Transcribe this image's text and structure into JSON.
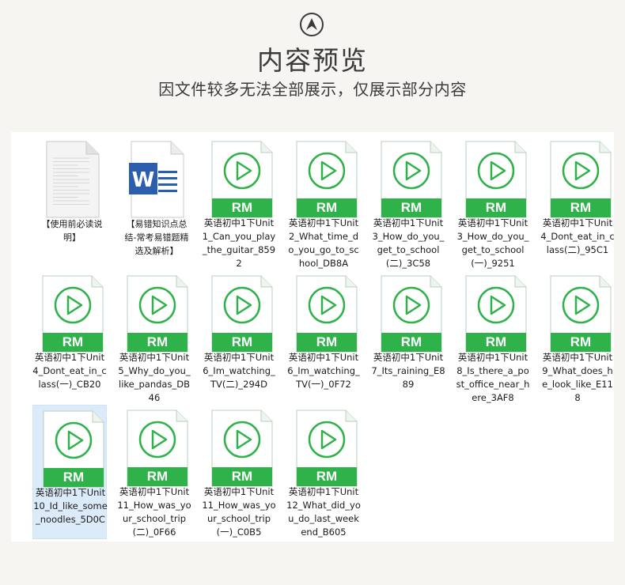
{
  "header": {
    "icon": "chevron-up-circle-icon",
    "title": "内容预览",
    "subtitle": "因文件较多无法全部展示，仅展示部分内容"
  },
  "colors": {
    "background": "#f7f5f1",
    "panel": "#ffffff",
    "rm_green": "#2fb24a",
    "text": "#3a3a3a",
    "selection": "#dcebfa",
    "word_blue": "#2b5fad"
  },
  "files": [
    {
      "type": "text-document-icon",
      "name": "【使用前必读说明】"
    },
    {
      "type": "word-document-icon",
      "name": "【易错知识点总结-常考易错题精选及解析】"
    },
    {
      "type": "rm-media-icon",
      "badge": "RM",
      "name": "英语初中1下Unit1_Can_you_play_the_guitar_8592"
    },
    {
      "type": "rm-media-icon",
      "badge": "RM",
      "name": "英语初中1下Unit2_What_time_do_you_go_to_school_DB8A"
    },
    {
      "type": "rm-media-icon",
      "badge": "RM",
      "name": "英语初中1下Unit3_How_do_you_get_to_school(二)_3C58"
    },
    {
      "type": "rm-media-icon",
      "badge": "RM",
      "name": "英语初中1下Unit3_How_do_you_get_to_school(一)_9251"
    },
    {
      "type": "rm-media-icon",
      "badge": "RM",
      "name": "英语初中1下Unit4_Dont_eat_in_class(二)_95C1"
    },
    {
      "type": "rm-media-icon",
      "badge": "RM",
      "name": "英语初中1下Unit4_Dont_eat_in_class(一)_CB20"
    },
    {
      "type": "rm-media-icon",
      "badge": "RM",
      "name": "英语初中1下Unit5_Why_do_you_like_pandas_DB46"
    },
    {
      "type": "rm-media-icon",
      "badge": "RM",
      "name": "英语初中1下Unit6_Im_watching_TV(二)_294D"
    },
    {
      "type": "rm-media-icon",
      "badge": "RM",
      "name": "英语初中1下Unit6_Im_watching_TV(一)_0F72"
    },
    {
      "type": "rm-media-icon",
      "badge": "RM",
      "name": "英语初中1下Unit7_Its_raining_E889"
    },
    {
      "type": "rm-media-icon",
      "badge": "RM",
      "name": "英语初中1下Unit8_Is_there_a_post_office_near_here_3AF8"
    },
    {
      "type": "rm-media-icon",
      "badge": "RM",
      "name": "英语初中1下Unit9_What_does_he_look_like_E118"
    },
    {
      "type": "rm-media-icon",
      "badge": "RM",
      "name": "英语初中1下Unit10_Id_like_some_noodles_5D0C",
      "selected": true
    },
    {
      "type": "rm-media-icon",
      "badge": "RM",
      "name": "英语初中1下Unit11_How_was_your_school_trip(二)_0F66"
    },
    {
      "type": "rm-media-icon",
      "badge": "RM",
      "name": "英语初中1下Unit11_How_was_your_school_trip(一)_C0B5"
    },
    {
      "type": "rm-media-icon",
      "badge": "RM",
      "name": "英语初中1下Unit12_What_did_you_do_last_weekend_B605"
    }
  ]
}
